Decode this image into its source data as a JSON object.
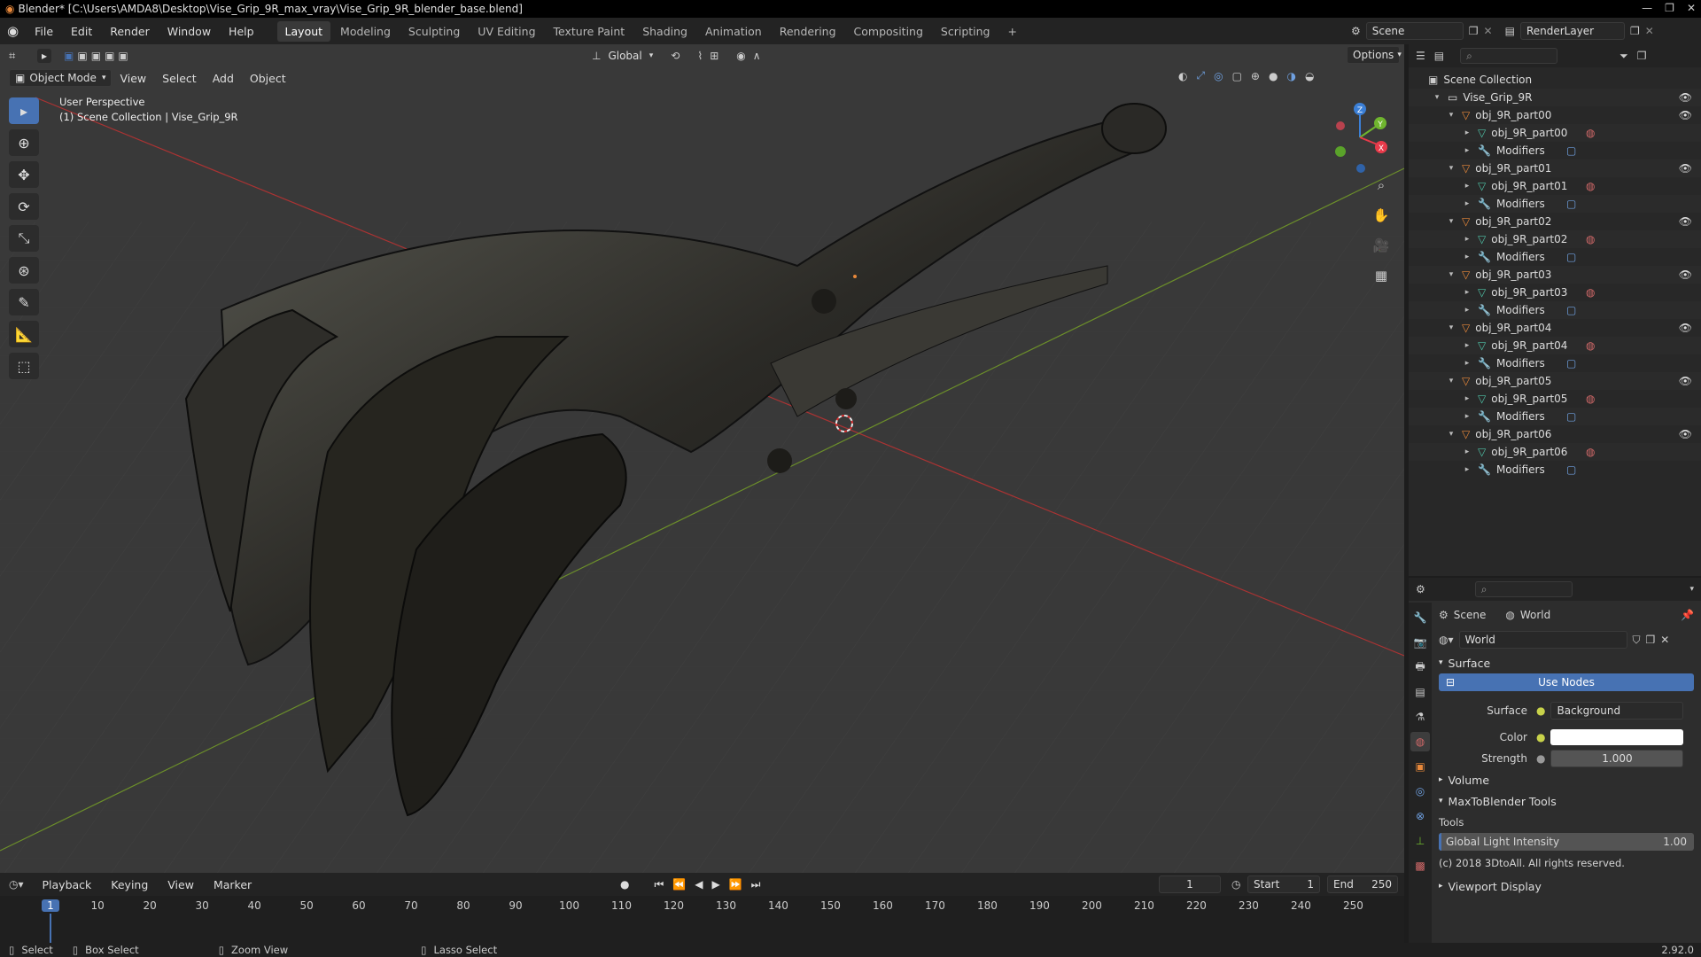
{
  "window": {
    "title": "Blender* [C:\\Users\\AMDA8\\Desktop\\Vise_Grip_9R_max_vray\\Vise_Grip_9R_blender_base.blend]"
  },
  "menus": [
    "File",
    "Edit",
    "Render",
    "Window",
    "Help"
  ],
  "workspaces": [
    "Layout",
    "Modeling",
    "Sculpting",
    "UV Editing",
    "Texture Paint",
    "Shading",
    "Animation",
    "Rendering",
    "Compositing",
    "Scripting"
  ],
  "scene": {
    "name": "Scene",
    "render_layer": "RenderLayer"
  },
  "viewport": {
    "orientation": "Global",
    "options_label": "Options",
    "mode": "Object Mode",
    "header_menus": [
      "View",
      "Select",
      "Add",
      "Object"
    ],
    "overlay_title": "User Perspective",
    "overlay_subtitle": "(1) Scene Collection | Vise_Grip_9R",
    "gizmo": {
      "x": "X",
      "y": "Y",
      "z": "Z"
    }
  },
  "outliner": {
    "root": "Scene Collection",
    "collection": "Vise_Grip_9R",
    "objects": [
      {
        "name": "obj_9R_part00",
        "mesh": "obj_9R_part00",
        "modifiers": "Modifiers"
      },
      {
        "name": "obj_9R_part01",
        "mesh": "obj_9R_part01",
        "modifiers": "Modifiers"
      },
      {
        "name": "obj_9R_part02",
        "mesh": "obj_9R_part02",
        "modifiers": "Modifiers"
      },
      {
        "name": "obj_9R_part03",
        "mesh": "obj_9R_part03",
        "modifiers": "Modifiers"
      },
      {
        "name": "obj_9R_part04",
        "mesh": "obj_9R_part04",
        "modifiers": "Modifiers"
      },
      {
        "name": "obj_9R_part05",
        "mesh": "obj_9R_part05",
        "modifiers": "Modifiers"
      },
      {
        "name": "obj_9R_part06",
        "mesh": "obj_9R_part06",
        "modifiers": "Modifiers"
      }
    ]
  },
  "properties": {
    "breadcrumb": {
      "scene": "Scene",
      "world": "World"
    },
    "world_name": "World",
    "surface_panel": "Surface",
    "use_nodes": "Use Nodes",
    "surface_label": "Surface",
    "surface_value": "Background",
    "color_label": "Color",
    "strength_label": "Strength",
    "strength_value": "1.000",
    "volume_panel": "Volume",
    "maxtoblender_panel": "MaxToBlender Tools",
    "tools_label": "Tools",
    "gli_label": "Global Light Intensity",
    "gli_value": "1.00",
    "copyright": "(c) 2018 3DtoAll. All rights reserved.",
    "viewport_display": "Viewport Display",
    "version": "2.92.0"
  },
  "timeline": {
    "menus": [
      "Playback",
      "Keying",
      "View",
      "Marker"
    ],
    "current_frame": "1",
    "start_label": "Start",
    "start": "1",
    "end_label": "End",
    "end": "250",
    "ticks": [
      "1",
      "10",
      "20",
      "30",
      "40",
      "50",
      "60",
      "70",
      "80",
      "90",
      "100",
      "110",
      "120",
      "130",
      "140",
      "150",
      "160",
      "170",
      "180",
      "190",
      "200",
      "210",
      "220",
      "230",
      "240",
      "250"
    ]
  },
  "status": {
    "select": "Select",
    "box_select": "Box Select",
    "zoom_view": "Zoom View",
    "lasso_select": "Lasso Select"
  },
  "colors": {
    "accent": "#4772b3",
    "object": "#e8883a",
    "mesh": "#4fc1a6",
    "x_axis": "#e83a4a",
    "y_axis": "#6fb52e",
    "z_axis": "#3b7fd6"
  }
}
